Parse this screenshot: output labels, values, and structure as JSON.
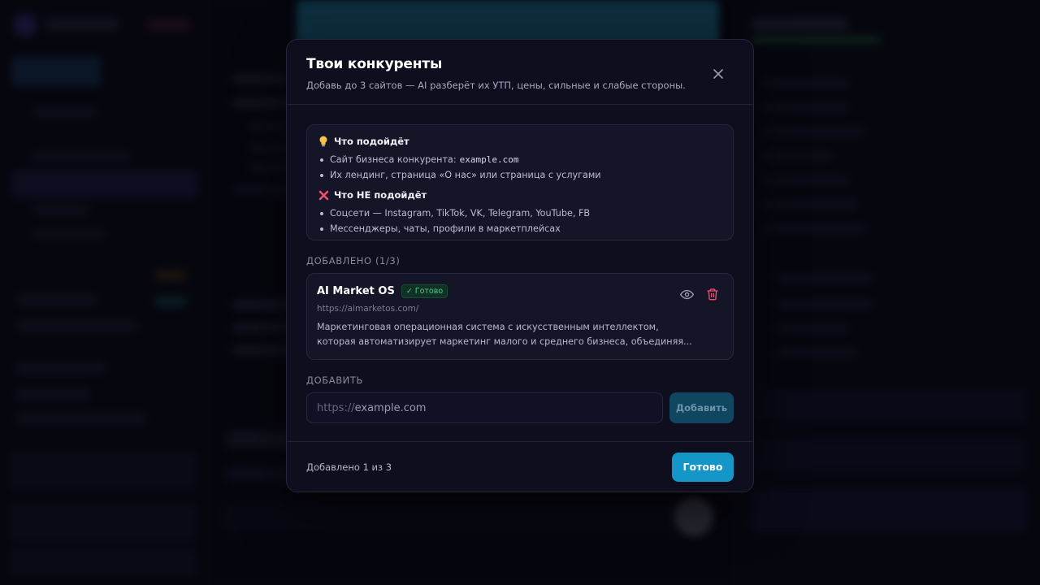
{
  "modal": {
    "title": "Твои конкуренты",
    "subtitle": "Добавь до 3 сайтов — AI разберёт их УТП, цены, сильные и слабые стороны."
  },
  "hints": {
    "good": {
      "icon": "lightbulb-icon",
      "title": "Что подойдёт",
      "items": [
        {
          "text": "Сайт бизнеса конкурента:",
          "code": "example.com"
        },
        {
          "text": "Их лендинг, страница «О нас» или страница с услугами",
          "code": ""
        }
      ]
    },
    "bad": {
      "icon": "cross-mark-icon",
      "title": "Что НЕ подойдёт",
      "items": [
        {
          "text": "Соцсети — Instagram, TikTok, VK, Telegram, YouTube, FB"
        },
        {
          "text": "Мессенджеры, чаты, профили в маркетплейсах"
        }
      ]
    }
  },
  "added": {
    "label": "ДОБАВЛЕНО (1/3)",
    "competitors": [
      {
        "name": "AI Market OS",
        "status": "✓ Готово",
        "url": "https://aimarketos.com/",
        "description_line1": "Маркетинговая операционная система с искусственным интеллектом,",
        "description_line2": "которая автоматизирует маркетинг малого и среднего бизнеса, объединяя..."
      }
    ]
  },
  "add_section": {
    "label": "ДОБАВИТЬ",
    "input_prefix": "https://",
    "input_placeholder": "example.com",
    "button_label": "Добавить"
  },
  "footer": {
    "count_text": "Добавлено 1 из 3",
    "done_label": "Готово"
  },
  "colors": {
    "accent": "#1596c9",
    "success": "#43d18a",
    "danger": "#f0506e",
    "modal_bg": "#0e0e1f"
  }
}
